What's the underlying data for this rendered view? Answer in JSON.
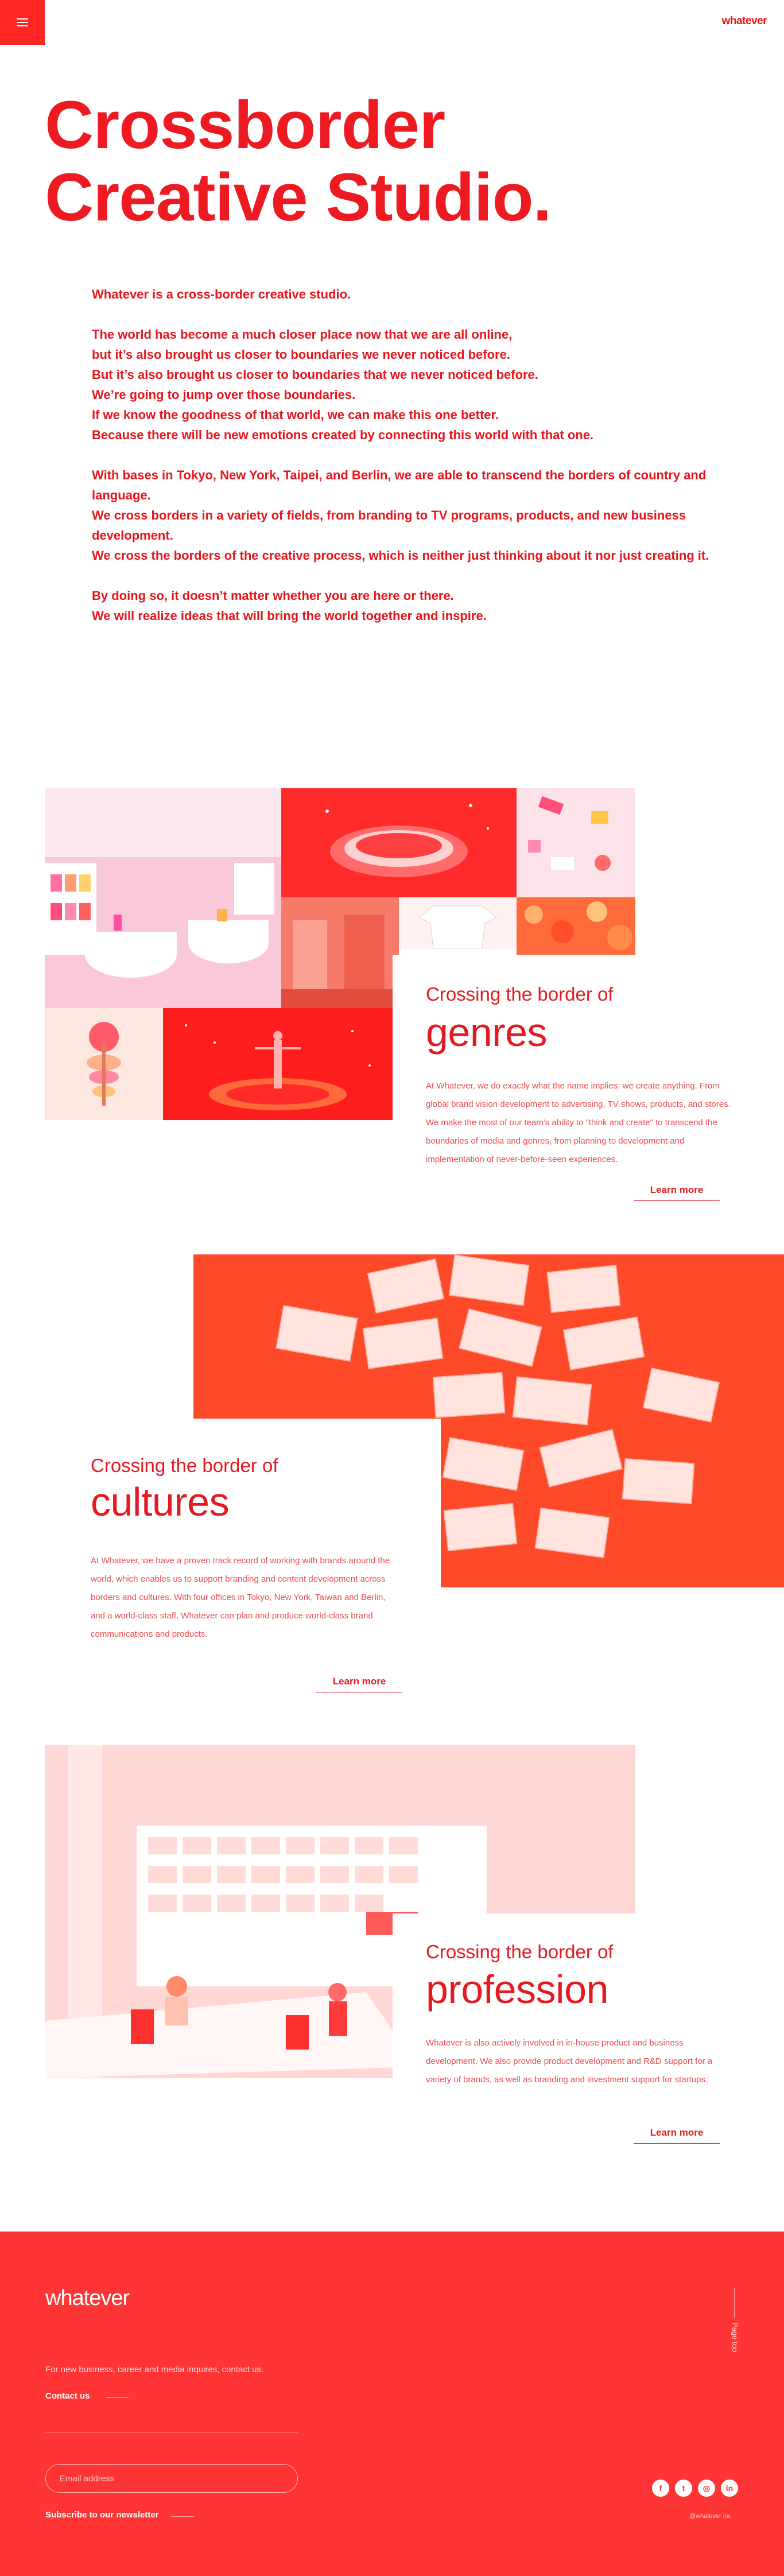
{
  "header": {
    "menu_icon": "hamburger-menu-icon",
    "logo": "whatever"
  },
  "hero": {
    "title_line1": "Crossborder",
    "title_line2": "Creative Studio."
  },
  "intro": {
    "p1": [
      "Whatever is a cross-border creative studio."
    ],
    "p2": [
      "The world has become a much closer place now that we are all online,",
      "but it’s also brought us closer to boundaries we never noticed before.",
      "But it’s also brought us closer to boundaries that we never noticed before.",
      "We’re going to jump over those boundaries.",
      "If we know the goodness of that world, we can make this one better.",
      "Because there will be new emotions created by connecting this world with that one."
    ],
    "p3": [
      "With bases in Tokyo, New York, Taipei, and Berlin, we are able to transcend the borders of country and language.",
      "We cross borders in a variety of fields, from branding to TV programs, products, and new business development.",
      "We cross the borders of the creative process, which is neither just thinking about it nor just creating it."
    ],
    "p4": [
      "By doing so, it doesn’t matter whether you are here or there.",
      "We will realize ideas that will bring the world together and inspire."
    ]
  },
  "sections": {
    "genres": {
      "kicker": "Crossing the border of",
      "title": "genres",
      "body": "At Whatever, we do exactly what the name implies: we create anything. From global brand vision development to advertising, TV shows, products, and stores. We make the most of our team's ability to \"think and create\" to transcend the boundaries of media and genres, from planning to development and implementation of never-before-seen experiences.",
      "link": "Learn more"
    },
    "cultures": {
      "kicker": "Crossing the border of",
      "title": "cultures",
      "body": "At Whatever, we have a proven track record of working with brands around the world, which enables us to support branding and content development across borders and cultures. With four offices in Tokyo, New York, Taiwan and Berlin, and a world-class staff, Whatever can plan and produce world-class brand communications and products.",
      "link": "Learn more"
    },
    "profession": {
      "kicker": "Crossing the border of",
      "title": "profession",
      "body": "Whatever is also actively involved in in-house product and business development. We also provide product development and R&D support for a variety of brands, as well as branding and investment support for startups.",
      "link": "Learn more"
    }
  },
  "footer": {
    "logo": "whatever",
    "note": "For new business, career and media inquires, contact us.",
    "contact": "Contact us",
    "email_placeholder": "Email address",
    "subscribe": "Subscribe to our newsletter",
    "page_top": "Page top",
    "socials": [
      "facebook-icon",
      "twitter-icon",
      "instagram-icon",
      "linkedin-icon"
    ],
    "copyright": "@whatever inc."
  },
  "colors": {
    "brand_red": "#ff2626",
    "text_red": "#e8141c",
    "footer_red": "#ff3434"
  }
}
